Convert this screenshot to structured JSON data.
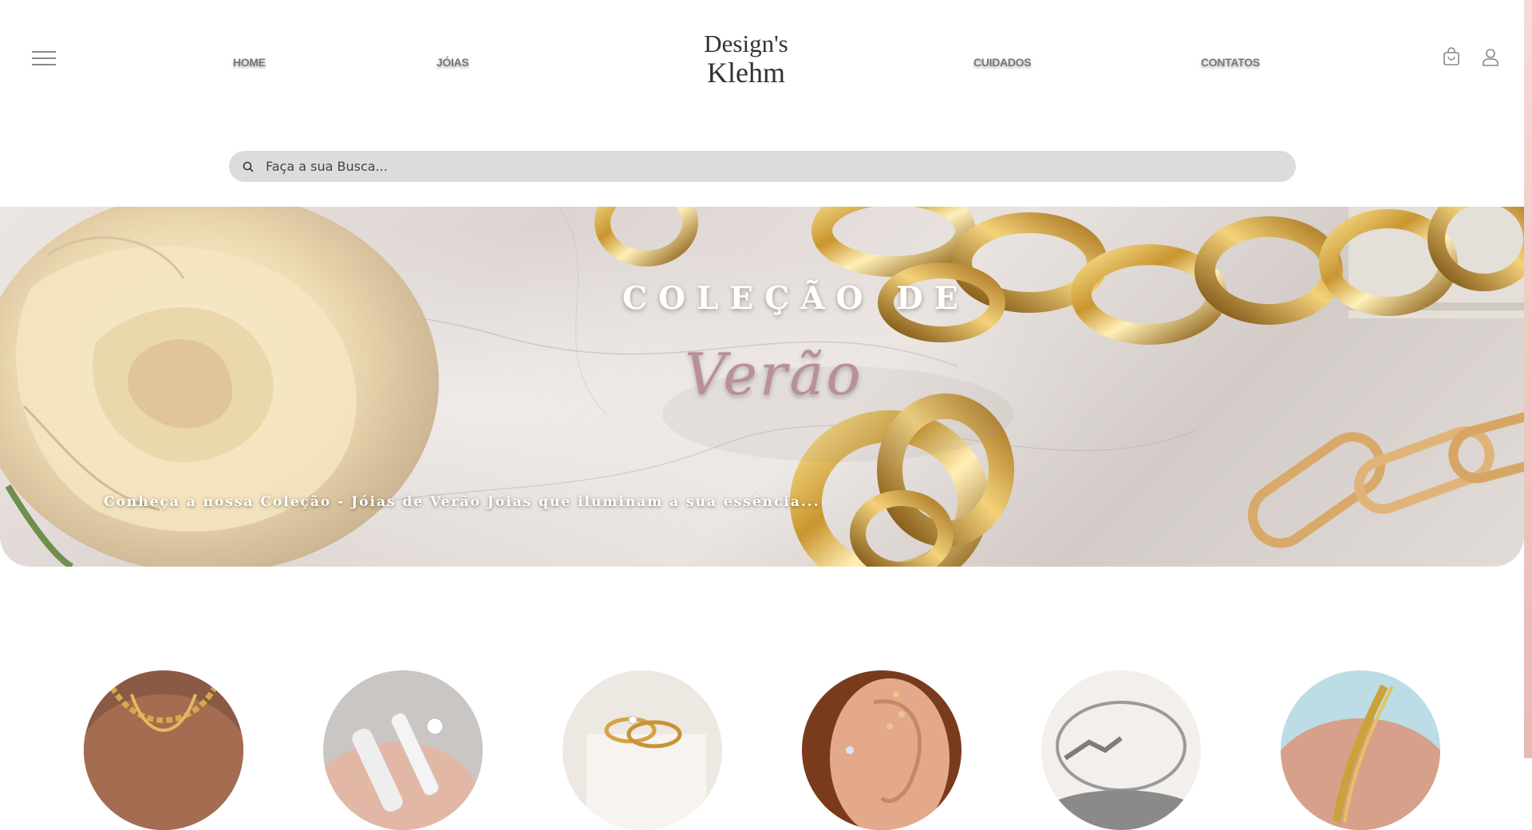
{
  "header": {
    "logo_line1": "Design's",
    "logo_line2": "Klehm",
    "nav": [
      "HOME",
      "JÓIAS",
      "CUIDADOS",
      "CONTATOS"
    ],
    "icons": [
      "menu-icon",
      "shopping-bag-icon",
      "user-icon"
    ]
  },
  "search": {
    "placeholder": "Faça a sua Busca...",
    "icon": "search-icon"
  },
  "hero": {
    "title": "COLEÇÃO DE",
    "subtitle": "Verão",
    "description": "Conheça a nossa Coleção - Jóias de Verão Jóias que iluminam a sua essência..."
  },
  "categories": [
    "necklace-category-image",
    "rings-category-image",
    "wedding-rings-category-image",
    "earrings-category-image",
    "bangle-category-image",
    "bracelet-category-image"
  ],
  "colors": {
    "search_bg": "#dcdcdc",
    "accent_rose": "#b89098",
    "nav_text": "#7a7a7a",
    "gold": "#c9952e"
  }
}
